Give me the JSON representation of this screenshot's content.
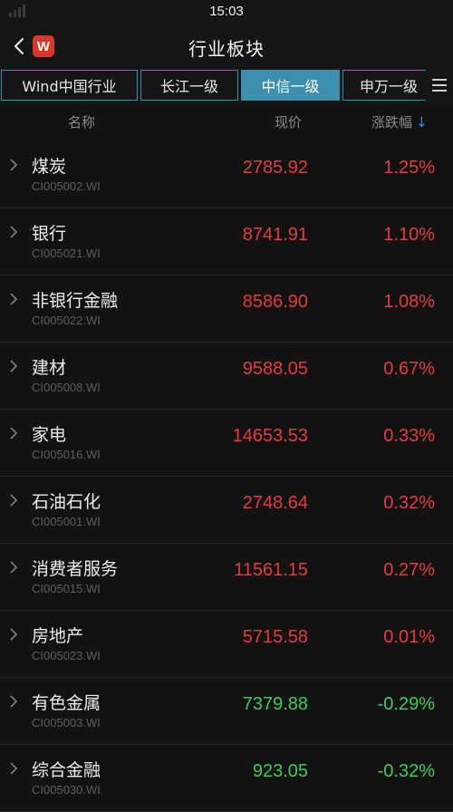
{
  "status_bar": {
    "time": "15:03"
  },
  "header": {
    "title": "行业板块",
    "logo_letter": "W"
  },
  "tabs": [
    {
      "label": "Wind中国行业",
      "active": false
    },
    {
      "label": "长江一级",
      "active": false
    },
    {
      "label": "中信一级",
      "active": true
    },
    {
      "label": "申万一级",
      "active": false
    }
  ],
  "columns": {
    "name": "名称",
    "price": "现价",
    "change": "涨跌幅",
    "sort_icon": "↓"
  },
  "colors": {
    "up": "#e53b3b",
    "down": "#3ccc5a",
    "accent": "#3d8fb0"
  },
  "rows": [
    {
      "name": "煤炭",
      "code": "CI005002.WI",
      "price": "2785.92",
      "change": "1.25%",
      "dir": "up"
    },
    {
      "name": "银行",
      "code": "CI005021.WI",
      "price": "8741.91",
      "change": "1.10%",
      "dir": "up"
    },
    {
      "name": "非银行金融",
      "code": "CI005022.WI",
      "price": "8586.90",
      "change": "1.08%",
      "dir": "up"
    },
    {
      "name": "建材",
      "code": "CI005008.WI",
      "price": "9588.05",
      "change": "0.67%",
      "dir": "up"
    },
    {
      "name": "家电",
      "code": "CI005016.WI",
      "price": "14653.53",
      "change": "0.33%",
      "dir": "up"
    },
    {
      "name": "石油石化",
      "code": "CI005001.WI",
      "price": "2748.64",
      "change": "0.32%",
      "dir": "up"
    },
    {
      "name": "消费者服务",
      "code": "CI005015.WI",
      "price": "11561.15",
      "change": "0.27%",
      "dir": "up"
    },
    {
      "name": "房地产",
      "code": "CI005023.WI",
      "price": "5715.58",
      "change": "0.01%",
      "dir": "up"
    },
    {
      "name": "有色金属",
      "code": "CI005003.WI",
      "price": "7379.88",
      "change": "-0.29%",
      "dir": "down"
    },
    {
      "name": "综合金融",
      "code": "CI005030.WI",
      "price": "923.05",
      "change": "-0.32%",
      "dir": "down"
    }
  ]
}
